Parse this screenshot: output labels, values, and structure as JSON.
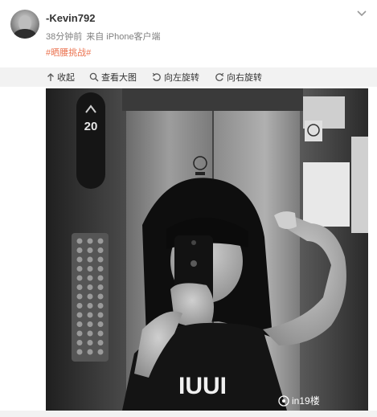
{
  "post": {
    "username": "-Kevin792",
    "time": "38分钟前",
    "source": "来自 iPhone客户端",
    "hashtag": "#晒腰挑战#"
  },
  "toolbar": {
    "collapse": "收起",
    "view_large": "查看大图",
    "rotate_left": "向左旋转",
    "rotate_right": "向右旋转"
  },
  "photo": {
    "floor_display": "20",
    "watermark_text": "in19楼"
  },
  "icons": {
    "more": "chevron-down-icon",
    "collapse": "arrow-up-icon",
    "view_large": "magnifier-icon",
    "rotate_left": "rotate-left-icon",
    "rotate_right": "rotate-right-icon"
  }
}
